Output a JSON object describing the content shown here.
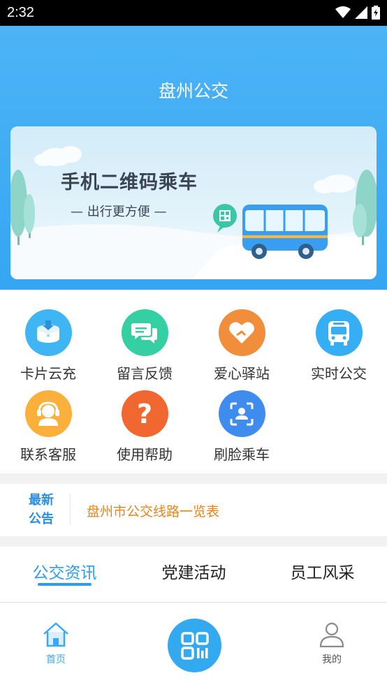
{
  "status_bar": {
    "time": "2:32"
  },
  "header": {
    "title": "盘州公交"
  },
  "banner": {
    "title": "手机二维码乘车",
    "subtitle": "— 出行更方便 —"
  },
  "grid": {
    "items": [
      {
        "label": "卡片云充",
        "icon": "card-recharge-icon",
        "color": "#3fb6f3"
      },
      {
        "label": "留言反馈",
        "icon": "message-feedback-icon",
        "color": "#34cfa3"
      },
      {
        "label": "爱心驿站",
        "icon": "heart-icon",
        "color": "#f08e3c"
      },
      {
        "label": "实时公交",
        "icon": "bus-icon",
        "color": "#35aef3"
      },
      {
        "label": "联系客服",
        "icon": "customer-service-icon",
        "color": "#fbb03b"
      },
      {
        "label": "使用帮助",
        "icon": "help-icon",
        "color": "#f0682f"
      },
      {
        "label": "刷脸乘车",
        "icon": "face-scan-icon",
        "color": "#3f8cef"
      }
    ]
  },
  "notice": {
    "tag_line1": "最新",
    "tag_line2": "公告",
    "text": "盘州市公交线路一览表"
  },
  "tabs": [
    {
      "label": "公交资讯",
      "active": true
    },
    {
      "label": "党建活动",
      "active": false
    },
    {
      "label": "员工风采",
      "active": false
    }
  ],
  "bottom_nav": {
    "home_label": "首页",
    "mine_label": "我的"
  },
  "colors": {
    "primary": "#35a6f3",
    "accent": "#e88419"
  }
}
